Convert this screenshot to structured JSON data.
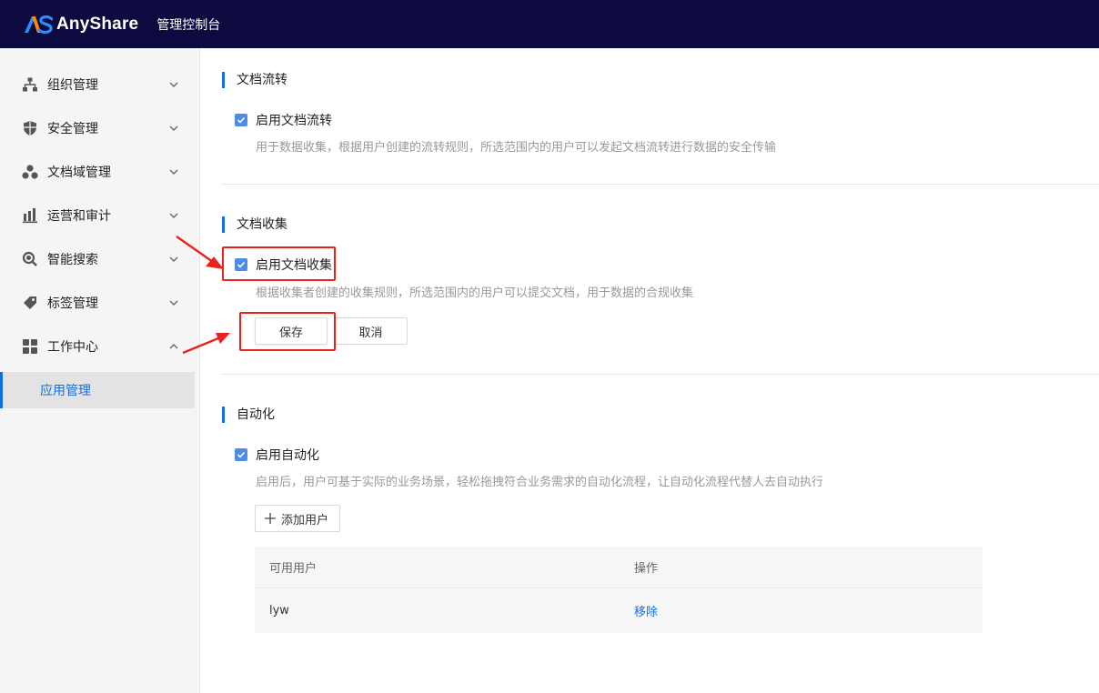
{
  "header": {
    "brand": "AnyShare",
    "console_title": "管理控制台"
  },
  "sidebar": {
    "items": [
      {
        "label": "组织管理",
        "icon": "org-tree-icon",
        "expanded": false
      },
      {
        "label": "安全管理",
        "icon": "shield-icon",
        "expanded": false
      },
      {
        "label": "文档域管理",
        "icon": "domain-cluster-icon",
        "expanded": false
      },
      {
        "label": "运营和审计",
        "icon": "bar-chart-icon",
        "expanded": false
      },
      {
        "label": "智能搜索",
        "icon": "search-icon",
        "expanded": false
      },
      {
        "label": "标签管理",
        "icon": "tag-icon",
        "expanded": false
      },
      {
        "label": "工作中心",
        "icon": "grid-icon",
        "expanded": true
      }
    ],
    "active_sub": "应用管理"
  },
  "sections": {
    "flow": {
      "title": "文档流转",
      "checkbox_label": "启用文档流转",
      "checked": true,
      "description": "用于数据收集，根据用户创建的流转规则，所选范围内的用户可以发起文档流转进行数据的安全传输"
    },
    "collect": {
      "title": "文档收集",
      "checkbox_label": "启用文档收集",
      "checked": true,
      "description": "根据收集者创建的收集规则，所选范围内的用户可以提交文档，用于数据的合规收集",
      "save_label": "保存",
      "cancel_label": "取消"
    },
    "automation": {
      "title": "自动化",
      "checkbox_label": "启用自动化",
      "checked": true,
      "description": "启用后，用户可基于实际的业务场景，轻松拖拽符合业务需求的自动化流程，让自动化流程代替人去自动执行",
      "add_user_label": "添加用户",
      "table": {
        "columns": [
          "可用用户",
          "操作"
        ],
        "rows": [
          {
            "user": "lyw",
            "action": "移除"
          }
        ]
      }
    }
  },
  "colors": {
    "topbar": "#0c0a3e",
    "accent": "#126ee3",
    "annotation": "#e8231e"
  }
}
